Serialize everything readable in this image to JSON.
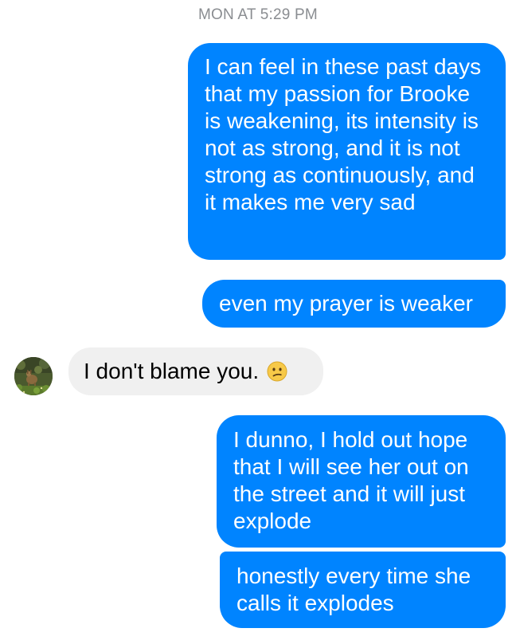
{
  "conversation": {
    "timestamp": "MON AT 5:29 PM",
    "messages": [
      {
        "sender": "me",
        "text": "I can feel in these past days that my passion for Brooke is weakening, its intensity is not as strong, and it is not strong as continuously, and it makes me very sad"
      },
      {
        "sender": "me",
        "text": "even my prayer is weaker"
      },
      {
        "sender": "them",
        "text": "I don't blame you.",
        "emoji": "confused-face"
      },
      {
        "sender": "me",
        "text": "I dunno, I hold out hope that I will see her out on the street and it will just explode"
      },
      {
        "sender": "me",
        "text": "honestly every time she calls it explodes"
      }
    ]
  },
  "contact": {
    "avatar_icon": "deer-photo-avatar"
  },
  "colors": {
    "outgoing_bubble": "#0084ff",
    "incoming_bubble": "#f0f0f0",
    "timestamp_text": "#8a8d91"
  }
}
